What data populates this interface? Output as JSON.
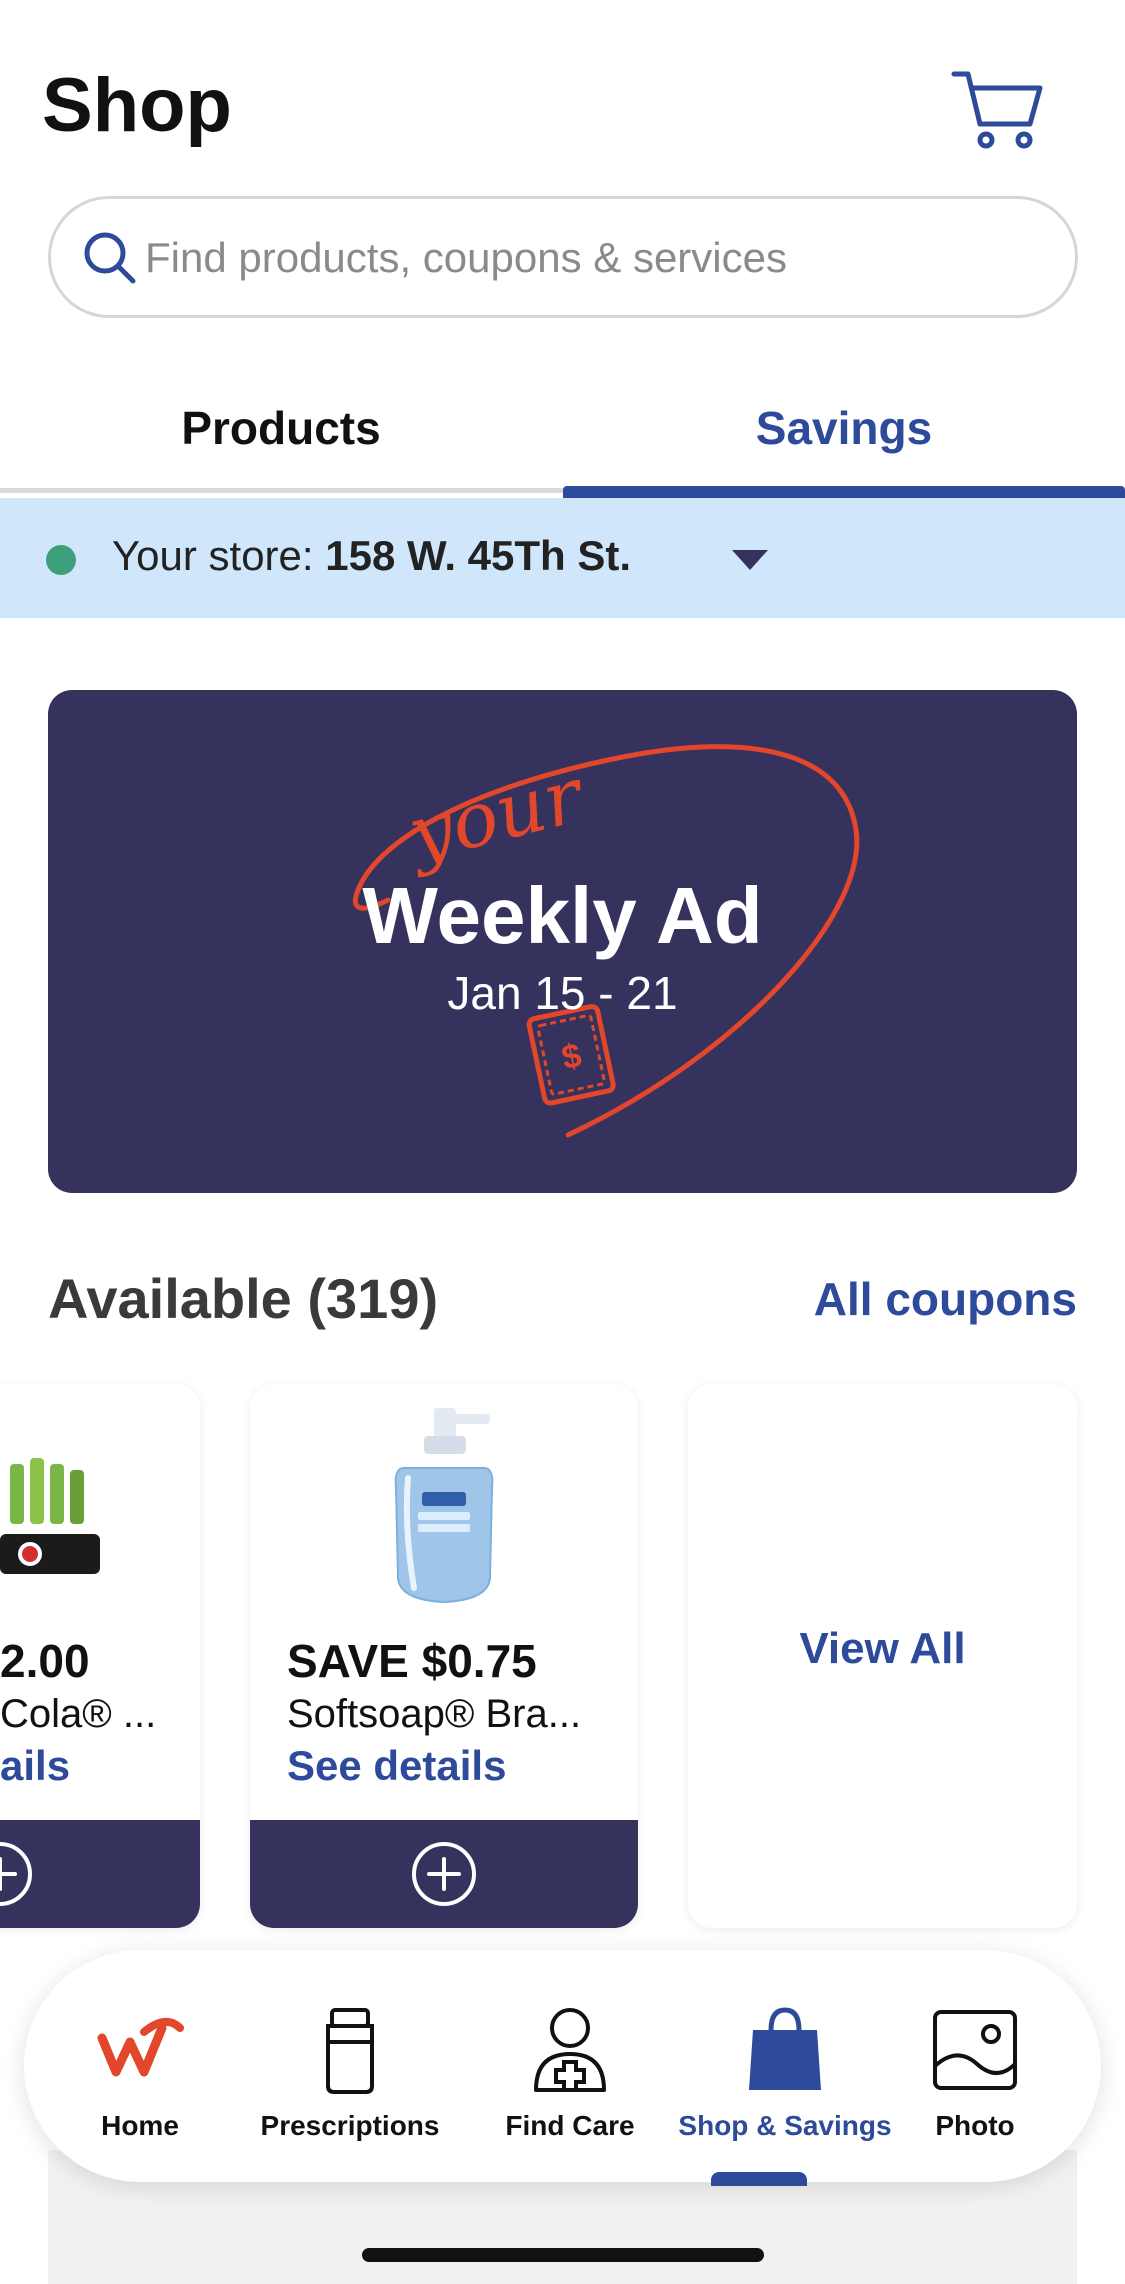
{
  "header": {
    "title": "Shop"
  },
  "search": {
    "placeholder": "Find products, coupons & services"
  },
  "tabs": [
    {
      "label": "Products",
      "active": false
    },
    {
      "label": "Savings",
      "active": true
    }
  ],
  "store": {
    "prefix": "Your store: ",
    "name": "158 W. 45Th St."
  },
  "weekly_ad": {
    "script_text": "your",
    "title": "Weekly Ad",
    "dates": "Jan 15 - 21"
  },
  "available": {
    "title": "Available (319)",
    "all_coupons_label": "All coupons"
  },
  "coupons": [
    {
      "save_text": "2.00",
      "product": "Cola® ...",
      "details_label": "ails"
    },
    {
      "save_text": "SAVE $0.75",
      "product": "Softsoap® Bra...",
      "details_label": "See details"
    }
  ],
  "view_all_label": "View All",
  "nav": [
    {
      "label": "Home",
      "icon": "walgreens-logo-icon",
      "active": false
    },
    {
      "label": "Prescriptions",
      "icon": "pill-bottle-icon",
      "active": false
    },
    {
      "label": "Find Care",
      "icon": "care-person-icon",
      "active": false
    },
    {
      "label": "Shop & Savings",
      "icon": "shopping-bag-icon",
      "active": true
    },
    {
      "label": "Photo",
      "icon": "photo-icon",
      "active": false
    }
  ],
  "colors": {
    "brand_blue": "#2e4a9a",
    "navy": "#35325e",
    "accent_red": "#e2462b",
    "store_bar": "#cfe6fb",
    "store_dot": "#3ea07a"
  }
}
